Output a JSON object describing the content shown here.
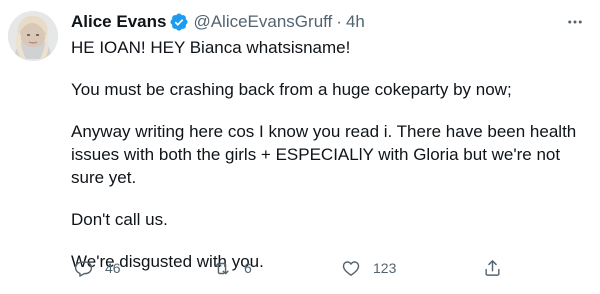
{
  "tweet": {
    "author": {
      "display_name": "Alice Evans",
      "handle": "@AliceEvansGruff",
      "verified": true
    },
    "separator": "·",
    "timestamp": "4h",
    "paragraphs": [
      "HE IOAN! HEY Bianca whatsisname!",
      "You must be crashing back from a huge cokeparty by now;",
      "Anyway writing here cos I know you read i. There have been health issues with both the girls + ESPECIALlY with Gloria but we're not sure yet.",
      "Don't call us.",
      "We're disgusted with you."
    ],
    "actions": {
      "reply": {
        "icon": "reply-icon",
        "count": "46"
      },
      "retweet": {
        "icon": "retweet-icon",
        "count": "6"
      },
      "like": {
        "icon": "heart-icon",
        "count": "123"
      },
      "share": {
        "icon": "share-icon"
      }
    }
  },
  "colors": {
    "text": "#0f1419",
    "secondary": "#536471",
    "verified": "#1d9bf0"
  }
}
